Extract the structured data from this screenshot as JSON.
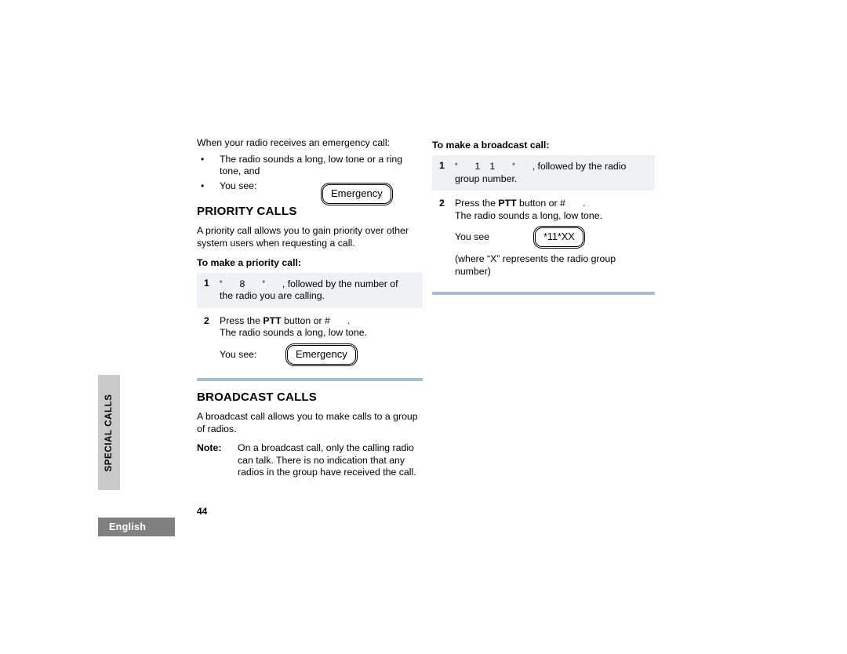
{
  "page": {
    "number": "44",
    "language_tab": "English",
    "section_tab": "SPECIAL CALLS"
  },
  "left_column": {
    "intro": "When your radio receives an emergency call:",
    "bullets": [
      {
        "marker": "•",
        "text": "The radio sounds a long, low tone or a ring tone, and"
      },
      {
        "marker": "•",
        "text": "You see:"
      }
    ],
    "emergency_display_1": "Emergency",
    "priority": {
      "heading": "PRIORITY CALLS",
      "body": "A priority call allows you to gain priority over other system users when requesting a call.",
      "sub_heading": "To make a priority call:",
      "steps": [
        {
          "number": "1",
          "keys": [
            "*",
            "8",
            "*"
          ],
          "text_after_keys": ", followed by the number of",
          "line2": "the radio you are calling.",
          "shaded": true
        },
        {
          "number": "2",
          "line1_before": "Press the ",
          "line1_bold": "PTT",
          "line1_after": " button or #",
          "line1_end": ".",
          "line2": "The radio sounds a long, low tone.",
          "display_label": "You see:",
          "display_value": "Emergency",
          "shaded": false
        }
      ]
    },
    "broadcast": {
      "heading": "BROADCAST CALLS",
      "body": "A broadcast call allows you to make calls to a group of radios.",
      "note_label": "Note:",
      "note_text": "On a broadcast call, only the calling radio can talk. There is no indication that any radios in the group have received the call."
    }
  },
  "right_column": {
    "sub_heading": "To make a broadcast call:",
    "steps": [
      {
        "number": "1",
        "keys": [
          "*",
          "1",
          "1",
          "*"
        ],
        "text_after_keys": ", followed by the radio",
        "line2": "group number.",
        "shaded": true
      },
      {
        "number": "2",
        "line1_before": "Press the ",
        "line1_bold": "PTT",
        "line1_after": " button or #",
        "line1_end": ".",
        "line2": "The radio sounds a long, low tone.",
        "display_label": "You see",
        "display_value": "*11*XX",
        "footnote": "(where “X” represents the radio group number)",
        "shaded": false
      }
    ]
  },
  "colors": {
    "rule": "#a9bdd1",
    "shaded_step_bg": "#eef1f5",
    "section_tab_bg": "#c9c9c9",
    "language_tab_bg": "#808080",
    "text": "#000000"
  }
}
